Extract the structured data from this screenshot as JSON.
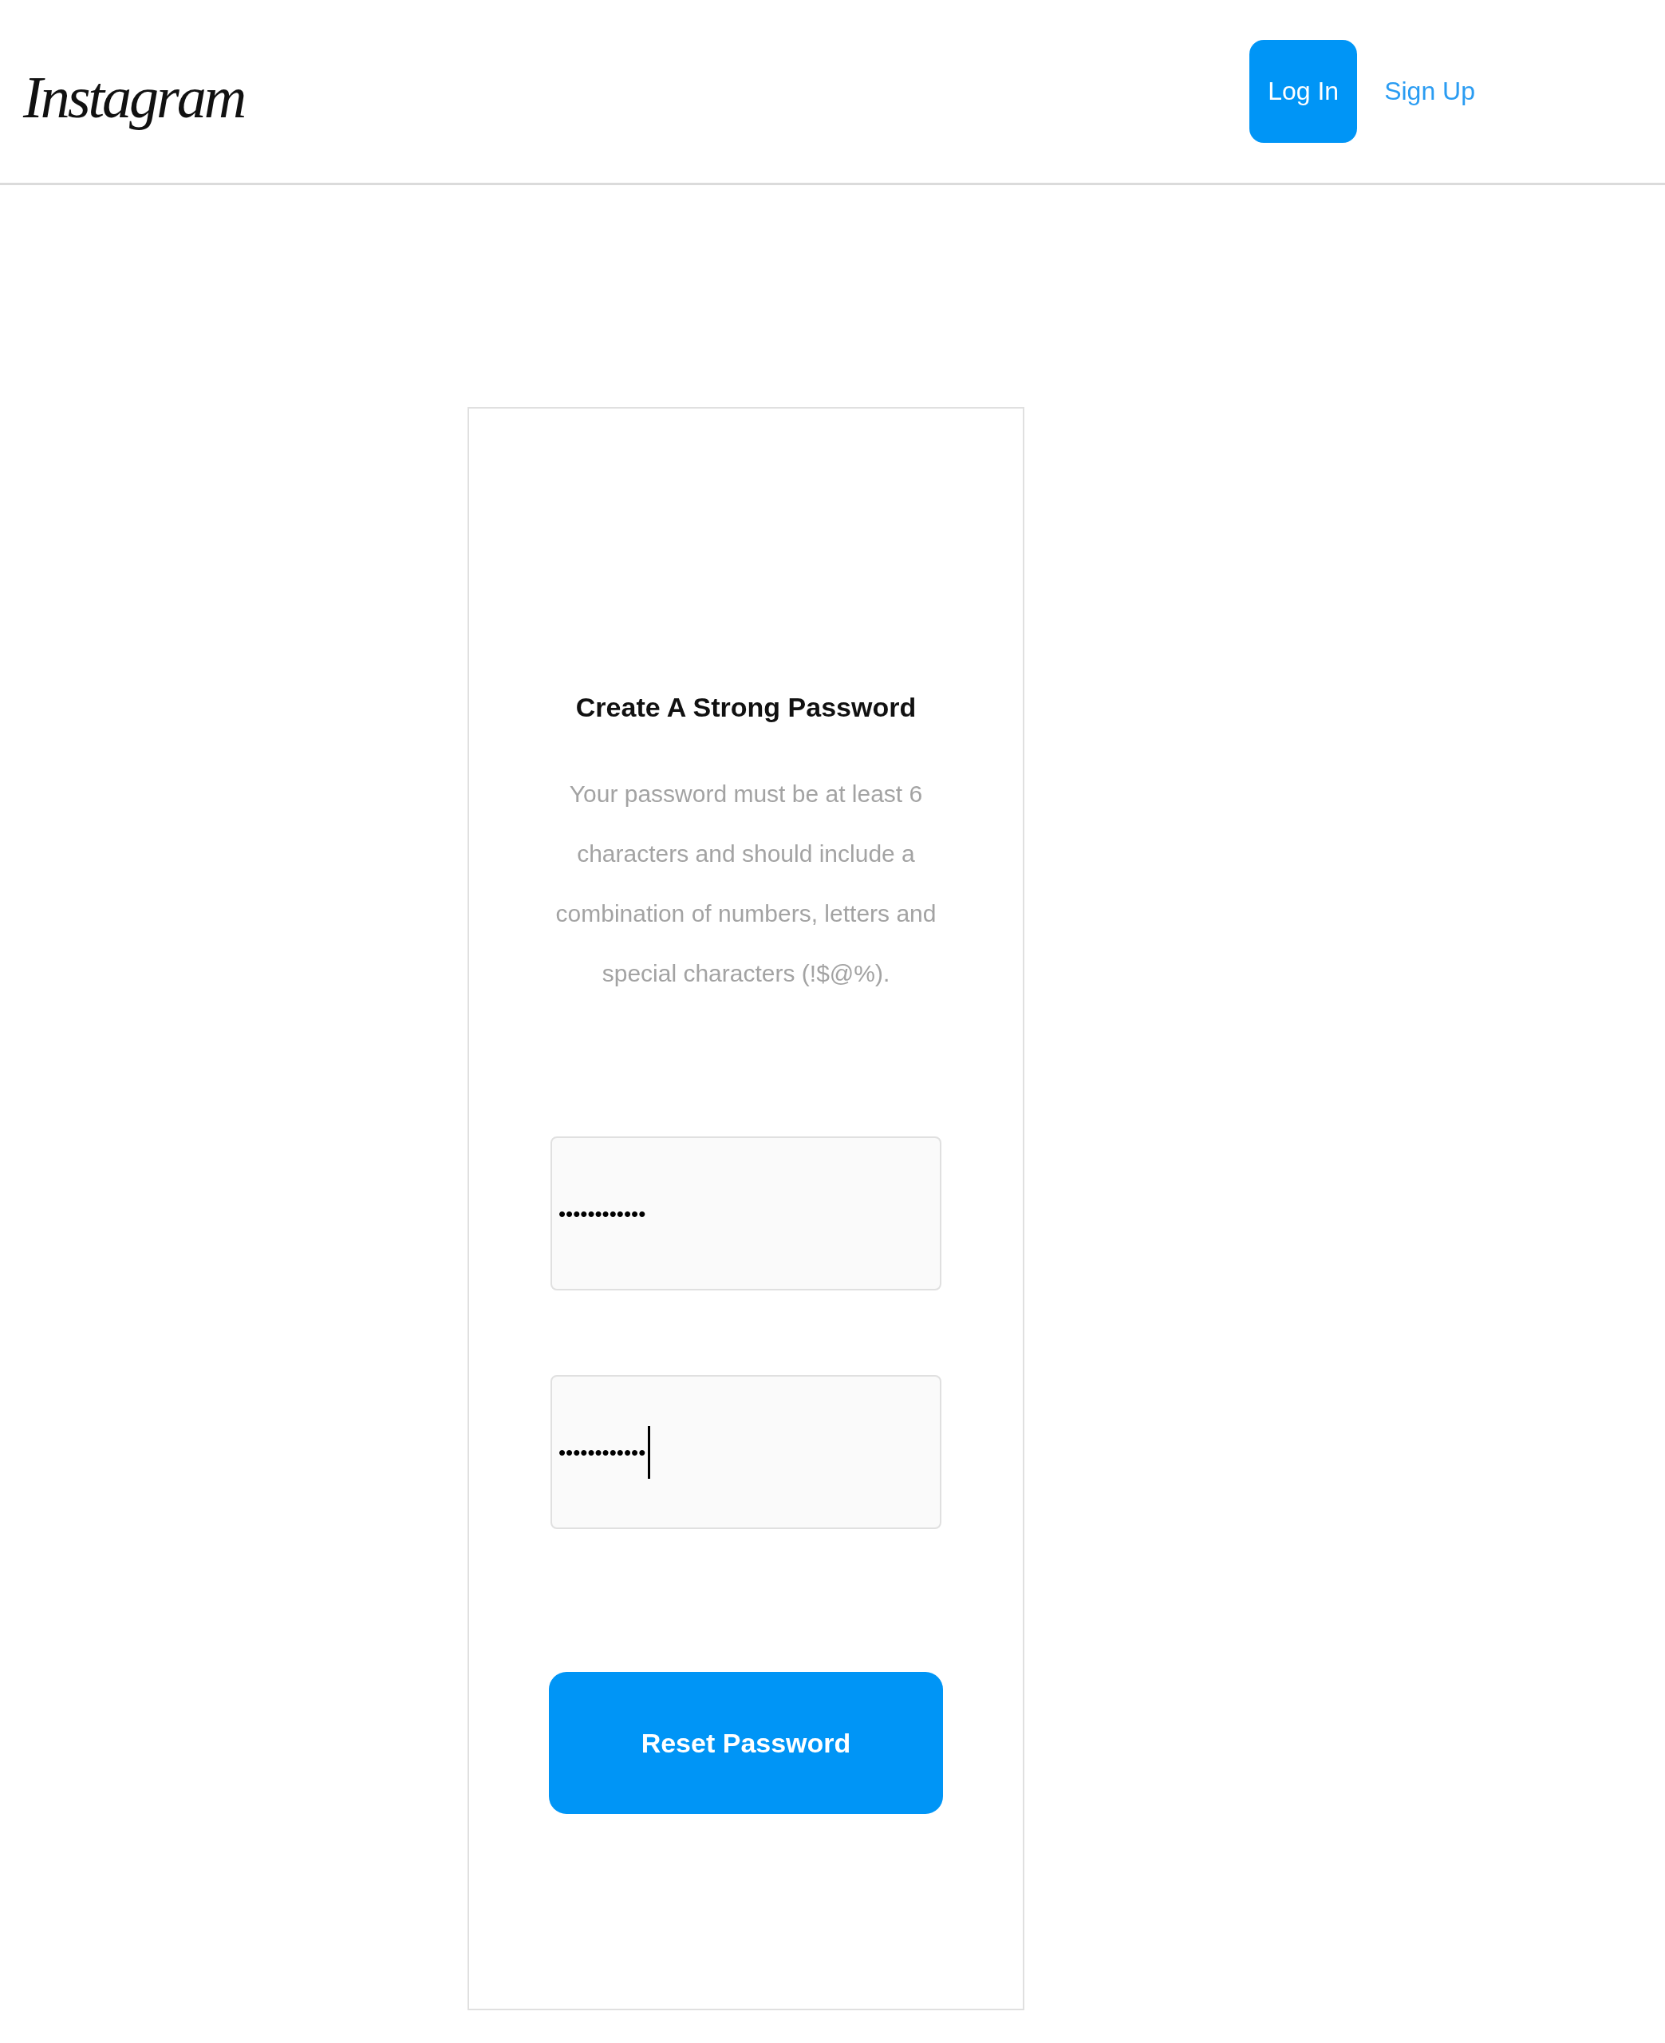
{
  "header": {
    "logo": "Instagram",
    "buttons": [
      {
        "label": "Log In",
        "kind": "primary"
      },
      {
        "label": "Sign Up",
        "kind": "link"
      }
    ]
  },
  "card": {
    "title": "Create A Strong Password",
    "description": "Your password must be at least 6 characters and should include a combination of numbers, letters and special characters (!$@%).",
    "fields": [
      {
        "value": "••••••••••••",
        "focused": false
      },
      {
        "value": "••••••••••••",
        "focused": true
      }
    ],
    "submit": "Reset Password"
  }
}
